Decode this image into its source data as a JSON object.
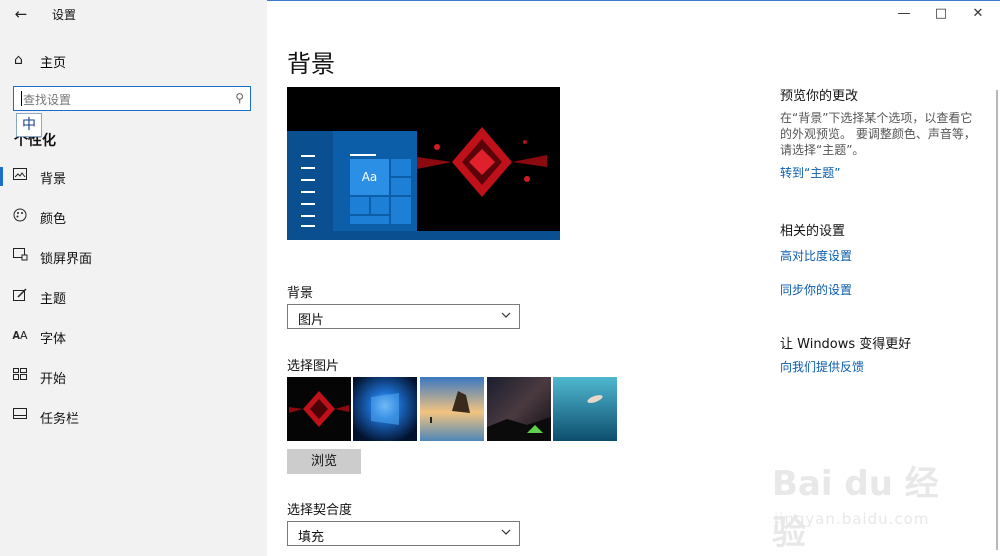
{
  "window": {
    "title": "设置",
    "controls": [
      "minimize",
      "maximize",
      "close"
    ]
  },
  "sidebar": {
    "home_label": "主页",
    "search": {
      "placeholder": "查找设置"
    },
    "ime_indicator": "中",
    "section_title": "个性化",
    "items": [
      {
        "label": "背景",
        "icon": "image-icon",
        "selected": true
      },
      {
        "label": "颜色",
        "icon": "palette-icon",
        "selected": false
      },
      {
        "label": "锁屏界面",
        "icon": "lock-screen-icon",
        "selected": false
      },
      {
        "label": "主题",
        "icon": "theme-icon",
        "selected": false
      },
      {
        "label": "字体",
        "icon": "font-icon",
        "selected": false
      },
      {
        "label": "开始",
        "icon": "start-icon",
        "selected": false
      },
      {
        "label": "任务栏",
        "icon": "taskbar-icon",
        "selected": false
      }
    ]
  },
  "main": {
    "title": "背景",
    "preview": {
      "sample_text": "Aa"
    },
    "background": {
      "label": "背景",
      "value": "图片"
    },
    "choose_picture": {
      "label": "选择图片",
      "thumbnails": [
        "red-abstract",
        "windows-blue",
        "beach-rocks",
        "night-sky-tent",
        "underwater-swimmer"
      ]
    },
    "browse_label": "浏览",
    "fit": {
      "label": "选择契合度",
      "value": "填充"
    }
  },
  "right_panel": {
    "preview_heading": "预览你的更改",
    "preview_text": "在“背景”下选择某个选项，以查看它的外观预览。 要调整颜色、声音等，请选择“主题”。",
    "goto_themes_link": "转到“主题”",
    "related_heading": "相关的设置",
    "high_contrast_link": "高对比度设置",
    "sync_link": "同步你的设置",
    "improve_heading": "让 Windows 变得更好",
    "feedback_link": "向我们提供反馈"
  },
  "watermark": {
    "line1": "Bai du 经验",
    "line2": "jingyan.baidu.com"
  },
  "colors": {
    "accent": "#1a6fc9",
    "link": "#0b5cad",
    "sidebar_bg": "#f2f2f2"
  }
}
